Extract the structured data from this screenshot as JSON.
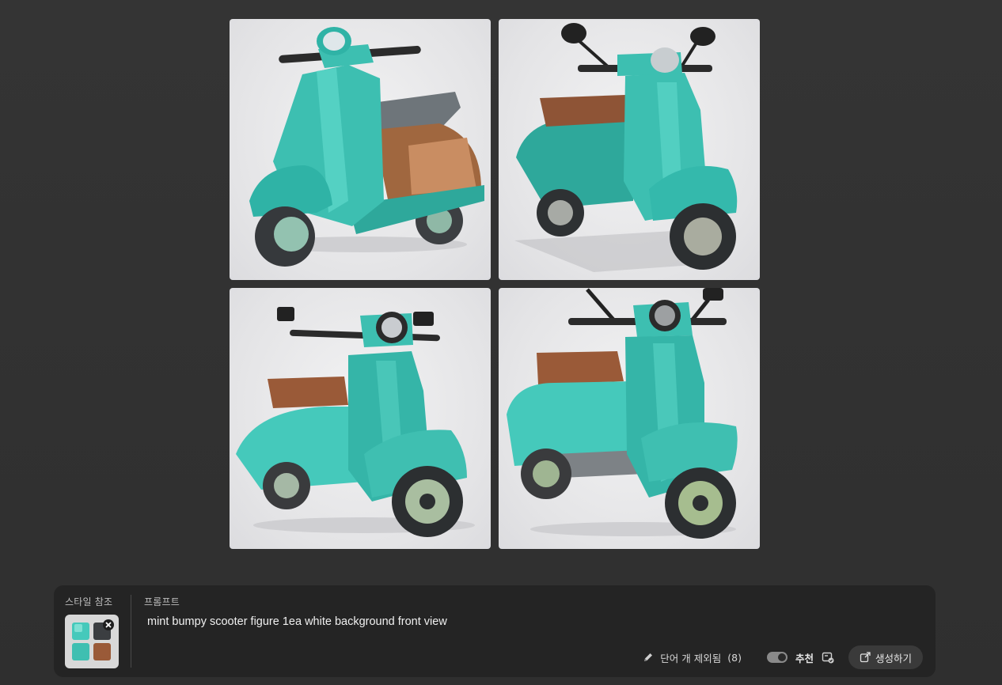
{
  "style_reference": {
    "label": "스타일 참조"
  },
  "prompt": {
    "label": "프롬프트",
    "text": "mint bumpy scooter figure 1ea white background front view"
  },
  "footer": {
    "excluded_words_label": "단어 개 제외됨",
    "excluded_words_count": "(8)",
    "recommend_label": "추천",
    "generate_label": "생성하기"
  },
  "colors": {
    "scooter_body": "#3fbdb0",
    "seat_brown": "#9a5a38",
    "panel_bg": "#242424"
  },
  "icons": [
    "pencil-icon",
    "recommend-toggle",
    "style-picker-icon",
    "generate-icon",
    "remove-icon"
  ]
}
